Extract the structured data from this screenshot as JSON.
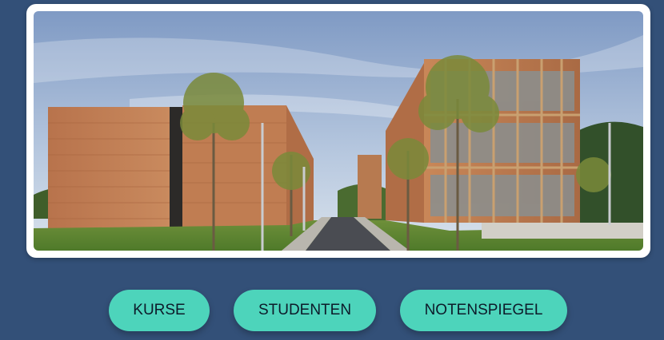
{
  "hero": {
    "image_icon": "campus-building-photo"
  },
  "nav": {
    "kurse_label": "KURSE",
    "studenten_label": "STUDENTEN",
    "notenspiegel_label": "NOTENSPIEGEL"
  },
  "colors": {
    "background": "#335078",
    "button": "#4dd4bb",
    "button_text": "#0d1b2a",
    "card": "#ffffff"
  }
}
